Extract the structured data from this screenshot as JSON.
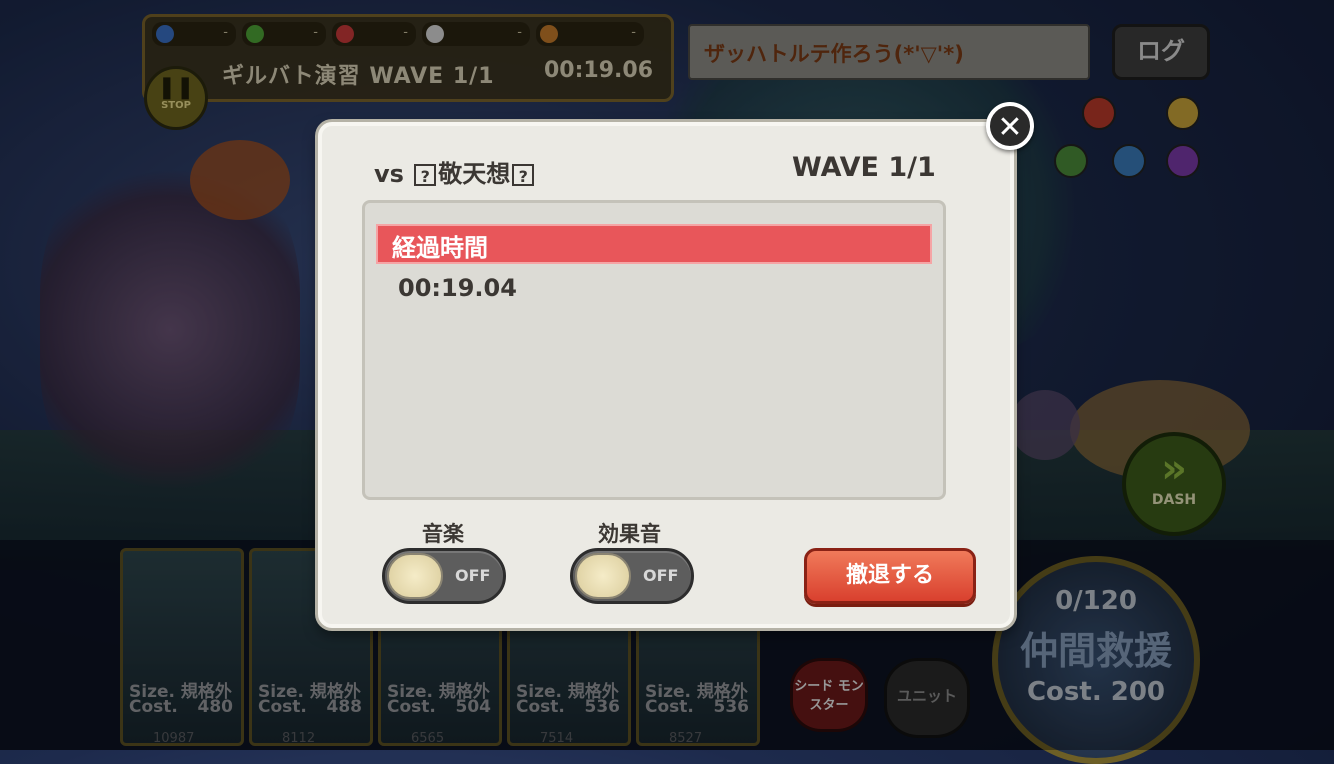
{
  "hud": {
    "slots": [
      {
        "value": "-",
        "gem_color": "#3a6fc4"
      },
      {
        "value": "-",
        "gem_color": "#4ea336"
      },
      {
        "value": "-",
        "gem_color": "#c83a3a"
      },
      {
        "value": "-",
        "gem_color": "#d8d8d8"
      },
      {
        "value": "-",
        "gem_color": "#c47a2a"
      }
    ],
    "battle_title": "ギルバト演習 WAVE 1/1",
    "battle_time": "00:19.06",
    "stop_label": "STOP"
  },
  "chat": {
    "text": "ザッハトルテ作ろう(*'▽'*)"
  },
  "log_button": "ログ",
  "dash_label": "DASH",
  "dialog": {
    "vs_prefix": "vs",
    "opponent_name": "敬天想",
    "unknown_glyph": "?",
    "wave": "WAVE 1/1",
    "elapsed_header": "経過時間",
    "elapsed_time": "00:19.04",
    "music_label": "音楽",
    "music_state": "OFF",
    "sfx_label": "効果音",
    "sfx_state": "OFF",
    "retreat_button": "撤退する",
    "close_glyph": "✕"
  },
  "units": [
    {
      "size": "Size. 規格外",
      "cost_label": "Cost.",
      "cost": "480",
      "id": "10987"
    },
    {
      "size": "Size. 規格外",
      "cost_label": "Cost.",
      "cost": "488",
      "id": "8112"
    },
    {
      "size": "Size. 規格外",
      "cost_label": "Cost.",
      "cost": "504",
      "id": "6565"
    },
    {
      "size": "Size. 規格外",
      "cost_label": "Cost.",
      "cost": "536",
      "id": "7514"
    },
    {
      "size": "Size. 規格外",
      "cost_label": "Cost.",
      "cost": "536",
      "id": "8527"
    }
  ],
  "seed_button": "シード モンスター",
  "unit_button": "ユニット",
  "rescue": {
    "count": "0/120",
    "title": "仲間救援",
    "cost": "Cost. 200"
  }
}
